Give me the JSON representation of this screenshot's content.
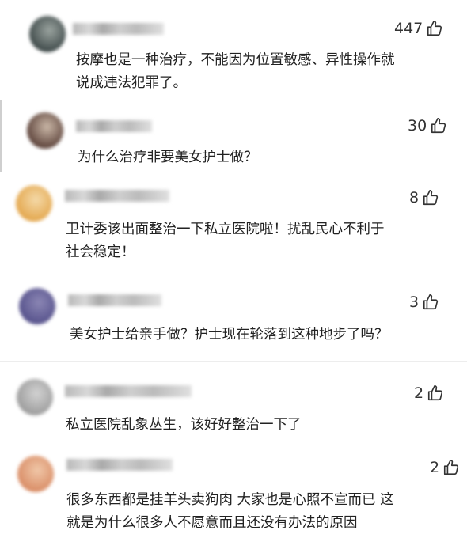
{
  "comments": [
    {
      "likes": "447",
      "lines": [
        "按摩也是一种治疗，不能因为位置敏感、异性操作就",
        "说成违法犯罪了。"
      ],
      "avatar_colors": [
        "#3c4747",
        "#9aa39f"
      ]
    },
    {
      "likes": "30",
      "lines": [
        "为什么治疗非要美女护士做？"
      ],
      "avatar_colors": [
        "#5a4038",
        "#c9b6a6"
      ]
    },
    {
      "likes": "8",
      "lines": [
        "卫计委该出面整治一下私立医院啦！扰乱民心不利于",
        "社会稳定！"
      ],
      "avatar_colors": [
        "#e3a54a",
        "#f4d9a8"
      ]
    },
    {
      "likes": "3",
      "lines": [
        "美女护士给亲手做？护士现在轮落到这种地步了吗？"
      ],
      "avatar_colors": [
        "#54508a",
        "#8b86b4"
      ]
    },
    {
      "likes": "2",
      "lines": [
        "私立医院乱象丛生，该好好整治一下了"
      ],
      "avatar_colors": [
        "#9a9a9a",
        "#d2d2d2"
      ]
    },
    {
      "likes": "2",
      "lines": [
        "很多东西都是挂羊头卖狗肉 大家也是心照不宣而已 这",
        "就是为什么很多人不愿意而且还没有办法的原因"
      ],
      "avatar_colors": [
        "#d88a63",
        "#f0c7a8"
      ]
    }
  ],
  "icons": {
    "like": "thumbs-up-icon"
  }
}
